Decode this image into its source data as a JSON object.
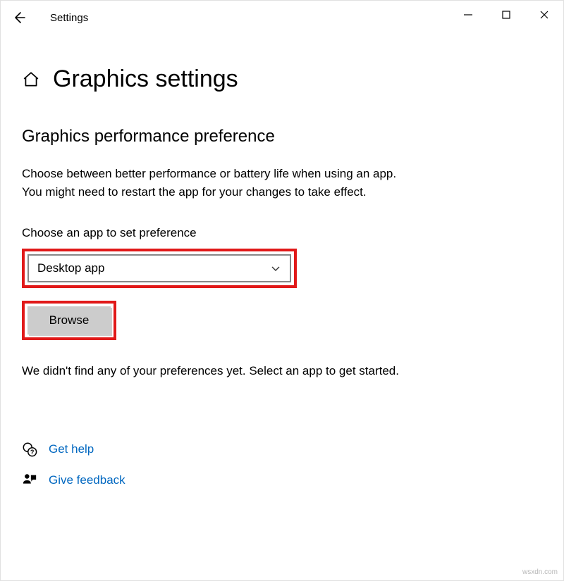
{
  "window": {
    "title": "Settings"
  },
  "page": {
    "title": "Graphics settings"
  },
  "section": {
    "title": "Graphics performance preference",
    "description_line1": "Choose between better performance or battery life when using an app.",
    "description_line2": "You might need to restart the app for your changes to take effect.",
    "choose_label": "Choose an app to set preference",
    "dropdown_selected": "Desktop app",
    "browse_label": "Browse",
    "status": "We didn't find any of your preferences yet. Select an app to get started."
  },
  "links": {
    "help": "Get help",
    "feedback": "Give feedback"
  },
  "watermark": "wsxdn.com"
}
